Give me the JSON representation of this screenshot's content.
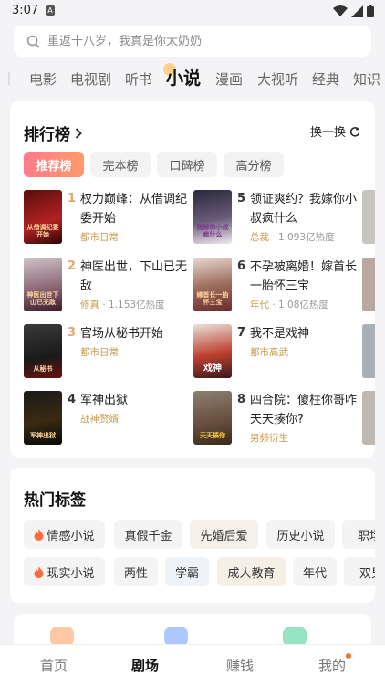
{
  "status": {
    "time": "3:07",
    "notif_glyph": "A"
  },
  "search": {
    "placeholder": "重返十八岁，我真是你太奶奶"
  },
  "categories": [
    "电影",
    "电视剧",
    "听书",
    "小说",
    "漫画",
    "大视听",
    "经典",
    "知识"
  ],
  "active_category": "小说",
  "ranking": {
    "title": "排行榜",
    "switch_label": "换一换",
    "tabs": [
      "推荐榜",
      "完本榜",
      "口碑榜",
      "高分榜"
    ],
    "active_tab": "推荐榜",
    "books": [
      {
        "num": "1",
        "name": "权力巅峰：从借调纪委开始",
        "genre": "都市日常",
        "heat": "",
        "cover_text": "从借调纪委开始"
      },
      {
        "num": "2",
        "name": "神医出世，下山已无敌",
        "genre": "修真",
        "heat": "1.153亿热度",
        "cover_text": "神医出世下山已无敌"
      },
      {
        "num": "3",
        "name": "官场从秘书开始",
        "genre": "都市日常",
        "heat": "",
        "cover_text": "从秘书"
      },
      {
        "num": "4",
        "name": "军神出狱",
        "genre": "战神赘婿",
        "heat": "",
        "cover_text": "军神出狱"
      },
      {
        "num": "5",
        "name": "领证爽约？我嫁你小叔疯什么",
        "genre": "总裁",
        "heat": "1.093亿热度",
        "cover_text": "我嫁你小叔疯什么"
      },
      {
        "num": "6",
        "name": "不孕被离婚！嫁首长一胎怀三宝",
        "genre": "年代",
        "heat": "1.08亿热度",
        "cover_text": "嫁首长一胎怀三宝"
      },
      {
        "num": "7",
        "name": "我不是戏神",
        "genre": "都市高武",
        "heat": "",
        "cover_text": "戏神"
      },
      {
        "num": "8",
        "name": "四合院：傻柱你哥咋天天揍你?",
        "genre": "男频衍生",
        "heat": "",
        "cover_text": "天天揍你"
      }
    ]
  },
  "hot_tags": {
    "title": "热门标签",
    "row1": [
      "情感小说",
      "真假千金",
      "先婚后爱",
      "历史小说",
      "职场"
    ],
    "row2": [
      "现实小说",
      "两性",
      "学霸",
      "成人教育",
      "年代",
      "双男"
    ]
  },
  "tabbar": [
    "首页",
    "剧场",
    "赚钱",
    "我的"
  ],
  "active_tabbar": "剧场",
  "colors": {
    "accent_gradient": [
      "#ff7a8a",
      "#ff9a6a"
    ],
    "genre": "#c79a4c",
    "rank_top": "#e8a66a"
  }
}
